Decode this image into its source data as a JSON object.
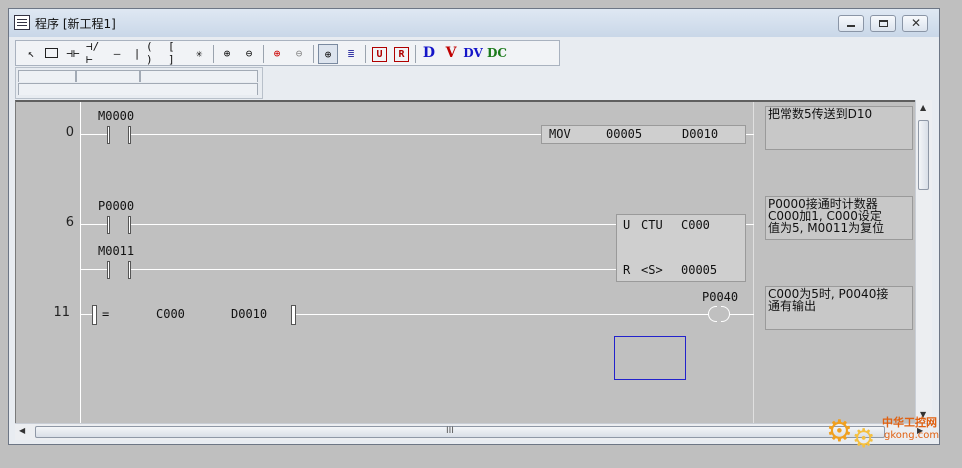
{
  "window": {
    "title": "程序 [新工程1]",
    "min_icon": "minimize-icon",
    "max_icon": "maximize-icon",
    "close_icon": "close-icon"
  },
  "toolbar": {
    "icons": [
      "select-arrow-icon",
      "box-icon",
      "no-contact-icon",
      "nc-contact-icon",
      "h-line-icon",
      "v-line-icon",
      "coil-icon",
      "func-box-icon",
      "wire-icon",
      "zoom-in-icon",
      "zoom-out-icon",
      "zoom-in-red-icon",
      "zoom-out-red-icon",
      "zoom-fit-icon",
      "align-icon",
      "u-icon",
      "r-icon",
      "d-icon",
      "v-icon",
      "dv-icon",
      "dc-icon"
    ],
    "letters": {
      "u": "U",
      "r": "R",
      "d": "D",
      "v": "V",
      "dv": "DV",
      "dc": "DC"
    }
  },
  "ladder": {
    "rungs": [
      {
        "step": "0",
        "contact": "M0000",
        "func": {
          "op": "MOV",
          "src": "00005",
          "dst": "D0010"
        }
      },
      {
        "step": "6",
        "contact": "P0000",
        "func": {
          "u_label": "U",
          "op": "CTU",
          "counter": "C000",
          "r_label": "R",
          "setting": "<S>",
          "value": "00005"
        },
        "reset_contact": "M0011"
      },
      {
        "step": "11",
        "compare": {
          "op": "=",
          "a": "C000",
          "b": "D0010"
        },
        "coil": "P0040"
      }
    ]
  },
  "comments": [
    "把常数5传送到D10",
    "P0000接通时计数器\nC000加1, C000设定\n值为5, M0011为复位",
    "C000为5时, P0040接\n通有输出"
  ],
  "scrollbar": {
    "grip": "III"
  },
  "watermark": {
    "brand": "中华工控网",
    "domain": "gkong.com"
  },
  "colors": {
    "cursor": "#2222cc",
    "ladder_bg": "#c0c0c0"
  }
}
